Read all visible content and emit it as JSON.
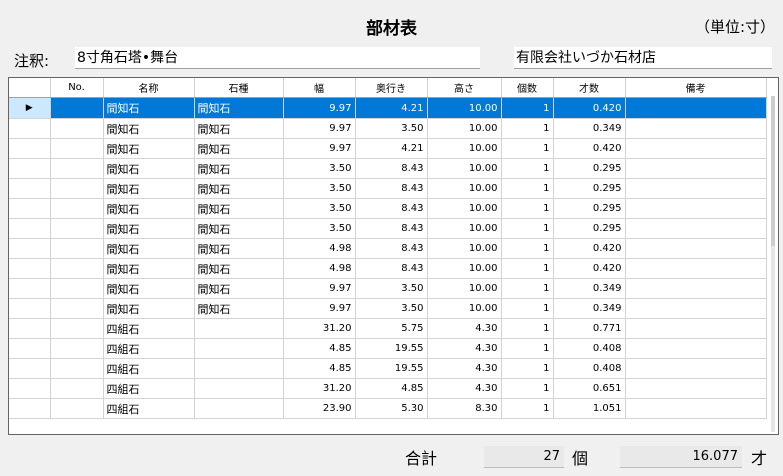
{
  "header": {
    "title": "部材表",
    "unit": "（単位:寸）"
  },
  "note": {
    "label": "注釈:",
    "value": "8寸角石塔•舞台",
    "company": "有限会社いづか石材店"
  },
  "grid": {
    "columns": [
      "No.",
      "名称",
      "石種",
      "幅",
      "奥行き",
      "高さ",
      "個数",
      "才数",
      "備考"
    ],
    "rows": [
      [
        "",
        "間知石",
        "間知石",
        "9.97",
        "4.21",
        "10.00",
        "1",
        "0.420",
        ""
      ],
      [
        "",
        "間知石",
        "間知石",
        "9.97",
        "3.50",
        "10.00",
        "1",
        "0.349",
        ""
      ],
      [
        "",
        "間知石",
        "間知石",
        "9.97",
        "4.21",
        "10.00",
        "1",
        "0.420",
        ""
      ],
      [
        "",
        "間知石",
        "間知石",
        "3.50",
        "8.43",
        "10.00",
        "1",
        "0.295",
        ""
      ],
      [
        "",
        "間知石",
        "間知石",
        "3.50",
        "8.43",
        "10.00",
        "1",
        "0.295",
        ""
      ],
      [
        "",
        "間知石",
        "間知石",
        "3.50",
        "8.43",
        "10.00",
        "1",
        "0.295",
        ""
      ],
      [
        "",
        "間知石",
        "間知石",
        "3.50",
        "8.43",
        "10.00",
        "1",
        "0.295",
        ""
      ],
      [
        "",
        "間知石",
        "間知石",
        "4.98",
        "8.43",
        "10.00",
        "1",
        "0.420",
        ""
      ],
      [
        "",
        "間知石",
        "間知石",
        "4.98",
        "8.43",
        "10.00",
        "1",
        "0.420",
        ""
      ],
      [
        "",
        "間知石",
        "間知石",
        "9.97",
        "3.50",
        "10.00",
        "1",
        "0.349",
        ""
      ],
      [
        "",
        "間知石",
        "間知石",
        "9.97",
        "3.50",
        "10.00",
        "1",
        "0.349",
        ""
      ],
      [
        "",
        "四組石",
        "",
        "31.20",
        "5.75",
        "4.30",
        "1",
        "0.771",
        ""
      ],
      [
        "",
        "四組石",
        "",
        "4.85",
        "19.55",
        "4.30",
        "1",
        "0.408",
        ""
      ],
      [
        "",
        "四組石",
        "",
        "4.85",
        "19.55",
        "4.30",
        "1",
        "0.408",
        ""
      ],
      [
        "",
        "四組石",
        "",
        "31.20",
        "4.85",
        "4.30",
        "1",
        "0.651",
        ""
      ],
      [
        "",
        "四組石",
        "",
        "23.90",
        "5.30",
        "8.30",
        "1",
        "1.051",
        ""
      ]
    ]
  },
  "summary": {
    "label": "合計",
    "count": "27",
    "count_unit": "個",
    "size": "16.077",
    "size_unit": "才"
  }
}
